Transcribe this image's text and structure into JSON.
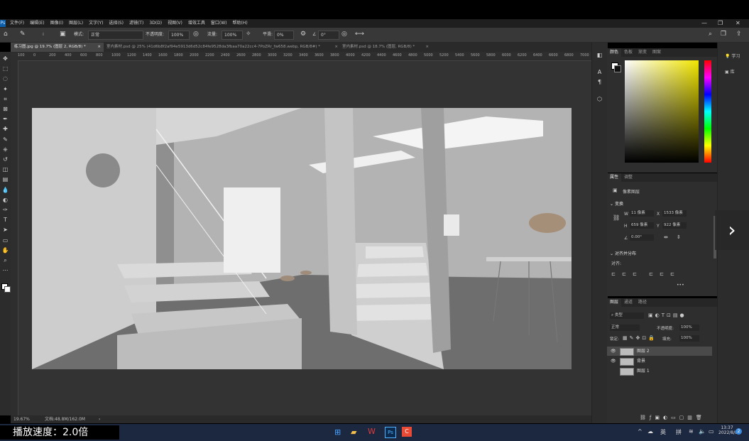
{
  "menubar": {
    "logo": "Ps",
    "items": [
      "文件(F)",
      "编辑(E)",
      "图像(I)",
      "图层(L)",
      "文字(Y)",
      "选择(S)",
      "滤镜(T)",
      "3D(D)",
      "视图(V)",
      "增效工具",
      "窗口(W)",
      "帮助(H)"
    ],
    "window_controls": [
      "—",
      "❐",
      "✕"
    ]
  },
  "options": {
    "mode_label": "模式:",
    "mode_value": "正常",
    "opacity_label": "不透明度:",
    "opacity_value": "100%",
    "flow_label": "流量:",
    "flow_value": "100%",
    "smooth_label": "平滑:",
    "smooth_value": "0%",
    "angle_value": "0°"
  },
  "tabs": [
    {
      "label": "练习图.jpg @ 19.7% (图层 2, RGB/8) *",
      "close": "×"
    },
    {
      "label": "室内素材.psd @ 25% (41d6b8f2af94e5913d6d52c84fe9528da3fbaa70a22cc4-7PoZRr_fw658.webp, RGB/8#) *",
      "close": "×"
    },
    {
      "label": "室内素材.psd @ 18.7% (图层, RGB/8) *",
      "close": "×"
    }
  ],
  "ruler_ticks": [
    "100",
    "0",
    "200",
    "400",
    "600",
    "800",
    "1000",
    "1200",
    "1400",
    "1600",
    "1800",
    "2000",
    "2200",
    "2400",
    "2600",
    "2800",
    "3000",
    "3200",
    "3400",
    "3600",
    "3800",
    "4000",
    "4200",
    "4400",
    "4600",
    "4800",
    "5000",
    "5200",
    "5400",
    "5600",
    "5800",
    "6000",
    "6200",
    "6400",
    "6600",
    "6800",
    "7000"
  ],
  "status": {
    "zoom": "19.67%",
    "doc": "文档:48.8M/162.0M",
    "arrow": "›"
  },
  "color_panel": {
    "tabs": [
      "颜色",
      "色板",
      "渐变",
      "图案"
    ]
  },
  "properties": {
    "tabs": [
      "属性",
      "调整"
    ],
    "pixel_layer": "像素图层",
    "transform_title": "变换",
    "w_label": "W",
    "w_value": "11 像素",
    "x_label": "X",
    "x_value": "1533 像素",
    "h_label": "H",
    "h_value": "659 像素",
    "y_label": "Y",
    "y_value": "922 像素",
    "angle_value": "0.00°",
    "align_title": "对齐并分布",
    "align_label": "对齐:",
    "more": "•••"
  },
  "layers": {
    "tabs": [
      "图层",
      "通道",
      "路径"
    ],
    "kind_label": "类型",
    "blend": "正常",
    "opacity_label": "不透明度:",
    "opacity_value": "100%",
    "lock_label": "锁定:",
    "fill_label": "填充:",
    "fill_value": "100%",
    "rows": [
      {
        "name": "图层 2",
        "visible": true,
        "selected": true
      },
      {
        "name": "背景",
        "visible": true,
        "selected": false
      },
      {
        "name": "图层 1",
        "visible": false,
        "selected": false
      }
    ]
  },
  "right_strip": {
    "learn": "学习",
    "libs": "库"
  },
  "taskbar": {
    "speed_label": "播放速度：2.0倍",
    "ime_lang": "英",
    "ime_pinyin": "拼",
    "time": "13:37",
    "date": "2022/8/8",
    "badge": "2"
  },
  "colors": {
    "accent": "#0c5ea8",
    "panel": "#2e2e2e",
    "taskbar": "#1c2740"
  }
}
